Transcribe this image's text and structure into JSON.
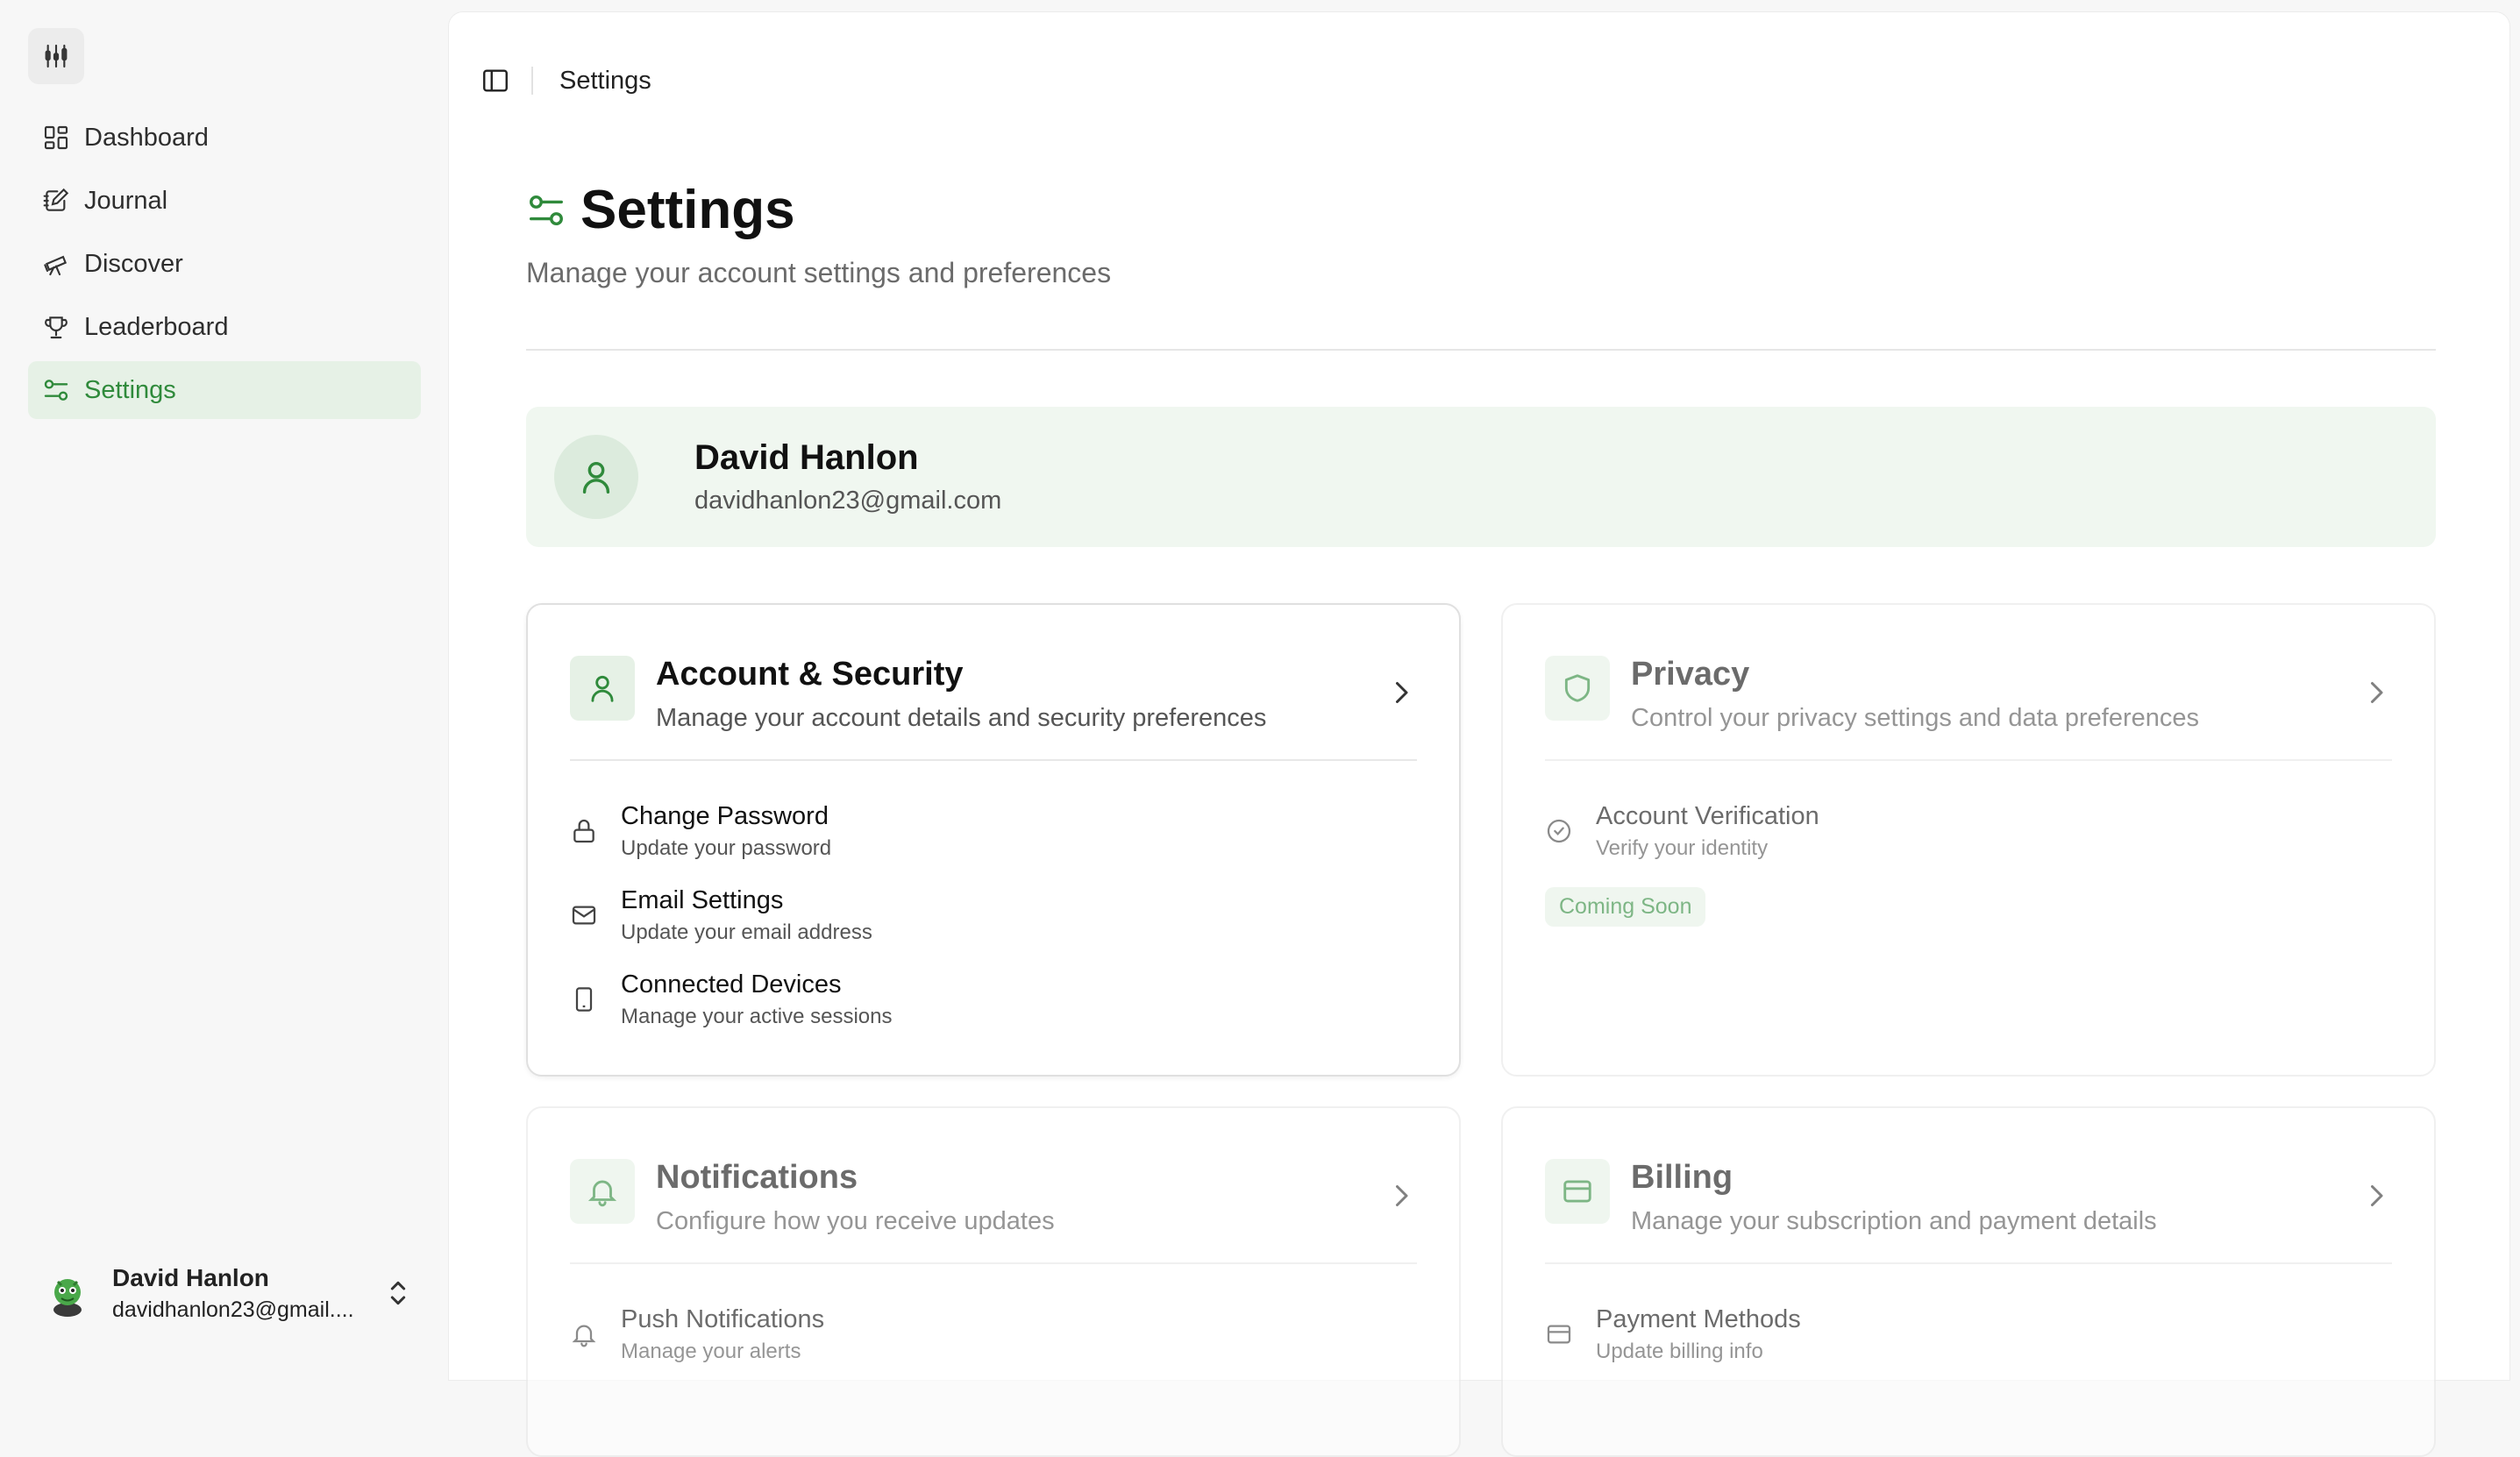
{
  "sidebar": {
    "items": [
      {
        "label": "Dashboard",
        "icon": "dashboard-icon"
      },
      {
        "label": "Journal",
        "icon": "journal-icon"
      },
      {
        "label": "Discover",
        "icon": "telescope-icon"
      },
      {
        "label": "Leaderboard",
        "icon": "trophy-icon"
      },
      {
        "label": "Settings",
        "icon": "settings-icon",
        "active": true
      }
    ],
    "user": {
      "name": "David Hanlon",
      "email": "davidhanlon23@gmail...."
    }
  },
  "topbar": {
    "breadcrumb": "Settings"
  },
  "page": {
    "title": "Settings",
    "subtitle": "Manage your account settings and preferences"
  },
  "profile": {
    "name": "David Hanlon",
    "email": "davidhanlon23@gmail.com"
  },
  "cards": [
    {
      "title": "Account & Security",
      "description": "Manage your account details and security preferences",
      "items": [
        {
          "title": "Change Password",
          "sub": "Update your password"
        },
        {
          "title": "Email Settings",
          "sub": "Update your email address"
        },
        {
          "title": "Connected Devices",
          "sub": "Manage your active sessions"
        }
      ]
    },
    {
      "title": "Privacy",
      "description": "Control your privacy settings and data preferences",
      "items": [
        {
          "title": "Account Verification",
          "sub": "Verify your identity"
        }
      ],
      "badge": "Coming Soon"
    },
    {
      "title": "Notifications",
      "description": "Configure how you receive updates",
      "items": [
        {
          "title": "Push Notifications",
          "sub": "Manage your alerts"
        }
      ]
    },
    {
      "title": "Billing",
      "description": "Manage your subscription and payment details",
      "items": [
        {
          "title": "Payment Methods",
          "sub": "Update billing info"
        }
      ]
    }
  ],
  "colors": {
    "accent": "#2f8a3b",
    "accent_bg": "#e6f1e6",
    "profile_bg": "#f0f7f0"
  }
}
